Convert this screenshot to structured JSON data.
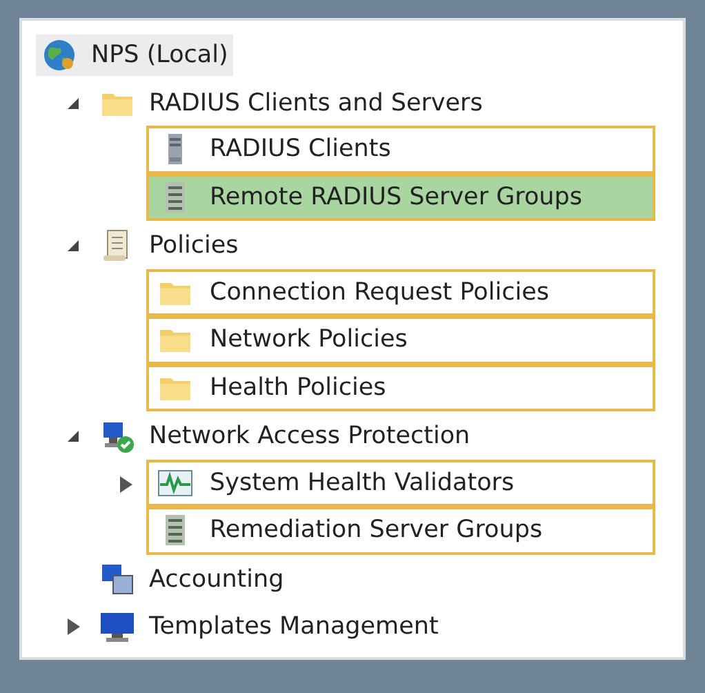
{
  "tree": [
    {
      "label": "NPS (Local)",
      "kind": "globe",
      "selected": true,
      "children": [
        {
          "label": "RADIUS Clients and Servers",
          "kind": "folder",
          "selected": false,
          "expanded": true,
          "children": [
            {
              "label": "RADIUS Clients",
              "kind": "server",
              "selected": false,
              "framed": true,
              "highlighted": false
            },
            {
              "label": "Remote RADIUS Server Groups",
              "kind": "servergroup",
              "selected": false,
              "framed": true,
              "highlighted": true
            }
          ]
        },
        {
          "label": "Policies",
          "kind": "scroll",
          "selected": false,
          "expanded": true,
          "children": [
            {
              "label": "Connection Request Policies",
              "kind": "folder",
              "selected": false,
              "framed": true,
              "highlighted": false
            },
            {
              "label": "Network Policies",
              "kind": "folder",
              "selected": false,
              "framed": true,
              "highlighted": false
            },
            {
              "label": "Health Policies",
              "kind": "folder",
              "selected": false,
              "framed": true,
              "highlighted": false
            }
          ]
        },
        {
          "label": "Network Access Protection",
          "kind": "nap",
          "selected": false,
          "expanded": true,
          "children": [
            {
              "label": "System Health Validators",
              "kind": "monitor",
              "selected": false,
              "expanded": false,
              "framed": true,
              "highlighted": false
            },
            {
              "label": "Remediation Server Groups",
              "kind": "servergroup",
              "selected": false,
              "framed": true,
              "highlighted": false
            }
          ]
        },
        {
          "label": "Accounting",
          "kind": "accounting",
          "selected": false
        },
        {
          "label": "Templates Management",
          "kind": "templates",
          "selected": false,
          "expanded": false
        }
      ]
    }
  ]
}
